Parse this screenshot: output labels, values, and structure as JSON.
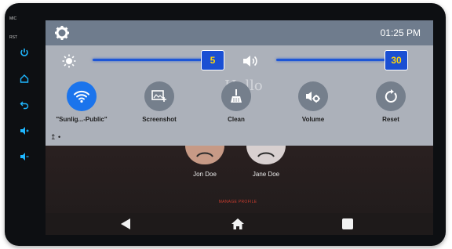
{
  "bezel": {
    "mic_label": "MIC",
    "rst_label": "RST"
  },
  "status": {
    "time": "01:25 PM"
  },
  "brightness": {
    "value": "5",
    "level": 5
  },
  "volume": {
    "value": "30",
    "level": 30
  },
  "watermark": "Hello",
  "actions": [
    {
      "label": "\"Sunlig...-Public\"",
      "icon": "wifi-icon"
    },
    {
      "label": "Screenshot",
      "icon": "screenshot-icon"
    },
    {
      "label": "Clean",
      "icon": "broom-icon"
    },
    {
      "label": "Volume",
      "icon": "volume-settings-icon"
    },
    {
      "label": "Reset",
      "icon": "reset-icon"
    }
  ],
  "upload": {
    "text": "↥ •"
  },
  "profiles": [
    {
      "name": "Jon Doe"
    },
    {
      "name": "Jane Doe"
    }
  ],
  "manage_profile": "MANAGE PROFILE",
  "colors": {
    "accent": "#1b74ec",
    "slider": "#1e56d6",
    "thumb_text": "#ffd60a",
    "bezel_button": "#1fb7ff"
  }
}
